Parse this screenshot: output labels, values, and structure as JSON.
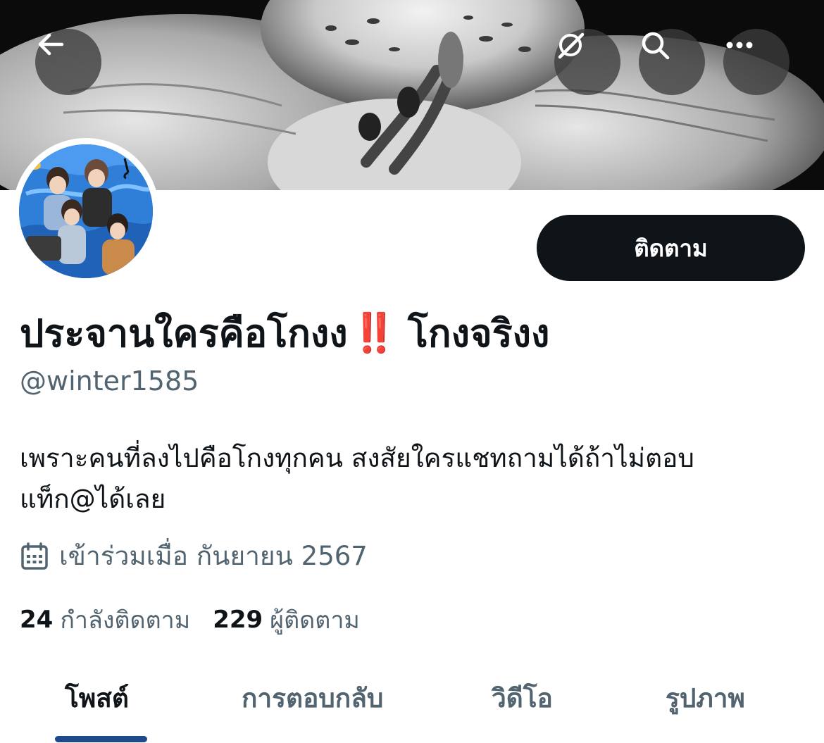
{
  "header": {
    "back_icon": "arrow-left-icon",
    "grok_icon": "grok-slash-icon",
    "search_icon": "search-icon",
    "more_icon": "more-horizontal-icon"
  },
  "profile": {
    "display_name": "ประจานใครคือโกงง",
    "display_emoji": "‼️",
    "display_name_suffix": "โกงจริงง",
    "handle": "@winter1585",
    "bio_line1": "เพราะคนที่ลงไปคือโกงทุกคน สงสัยใครแชทถามได้ถ้าไม่ตอบ",
    "bio_line2": "แท็ก@ได้เลย",
    "joined": "เข้าร่วมเมื่อ กันยายน 2567",
    "follow_label": "ติดตาม",
    "following_count": "24",
    "following_label": "กำลังติดตาม",
    "followers_count": "229",
    "followers_label": "ผู้ติดตาม"
  },
  "tabs": [
    {
      "label": "โพสต์",
      "active": true
    },
    {
      "label": "การตอบกลับ",
      "active": false
    },
    {
      "label": "วิดีโอ",
      "active": false
    },
    {
      "label": "รูปภาพ",
      "active": false
    }
  ],
  "colors": {
    "accent": "#1d4a8a",
    "alert": "#e0201b",
    "text": "#0f1419",
    "muted": "#536471"
  }
}
